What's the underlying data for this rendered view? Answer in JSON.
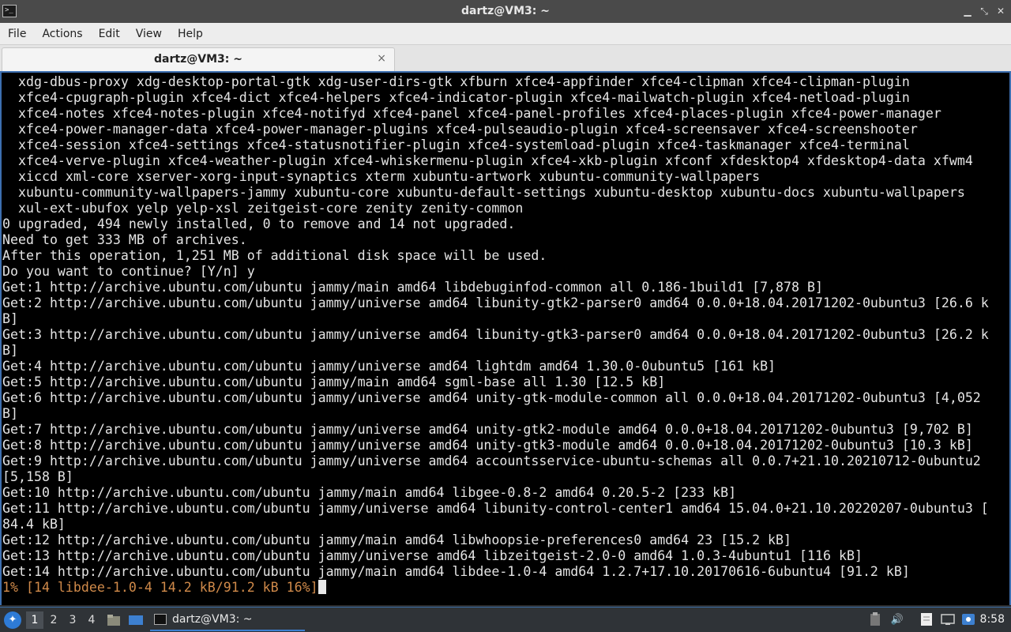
{
  "window": {
    "title": "dartz@VM3: ~",
    "minimize_glyph": "▁",
    "maximize_glyph": "⤡",
    "close_glyph": "✕"
  },
  "menubar": {
    "items": [
      "File",
      "Actions",
      "Edit",
      "View",
      "Help"
    ]
  },
  "tab": {
    "label": "dartz@VM3: ~",
    "close_glyph": "×"
  },
  "terminal": {
    "lines": [
      "  xdg-dbus-proxy xdg-desktop-portal-gtk xdg-user-dirs-gtk xfburn xfce4-appfinder xfce4-clipman xfce4-clipman-plugin",
      "  xfce4-cpugraph-plugin xfce4-dict xfce4-helpers xfce4-indicator-plugin xfce4-mailwatch-plugin xfce4-netload-plugin",
      "  xfce4-notes xfce4-notes-plugin xfce4-notifyd xfce4-panel xfce4-panel-profiles xfce4-places-plugin xfce4-power-manager",
      "  xfce4-power-manager-data xfce4-power-manager-plugins xfce4-pulseaudio-plugin xfce4-screensaver xfce4-screenshooter",
      "  xfce4-session xfce4-settings xfce4-statusnotifier-plugin xfce4-systemload-plugin xfce4-taskmanager xfce4-terminal",
      "  xfce4-verve-plugin xfce4-weather-plugin xfce4-whiskermenu-plugin xfce4-xkb-plugin xfconf xfdesktop4 xfdesktop4-data xfwm4",
      "  xiccd xml-core xserver-xorg-input-synaptics xterm xubuntu-artwork xubuntu-community-wallpapers",
      "  xubuntu-community-wallpapers-jammy xubuntu-core xubuntu-default-settings xubuntu-desktop xubuntu-docs xubuntu-wallpapers",
      "  xul-ext-ubufox yelp yelp-xsl zeitgeist-core zenity zenity-common",
      "0 upgraded, 494 newly installed, 0 to remove and 14 not upgraded.",
      "Need to get 333 MB of archives.",
      "After this operation, 1,251 MB of additional disk space will be used.",
      "Do you want to continue? [Y/n] y",
      "Get:1 http://archive.ubuntu.com/ubuntu jammy/main amd64 libdebuginfod-common all 0.186-1build1 [7,878 B]",
      "Get:2 http://archive.ubuntu.com/ubuntu jammy/universe amd64 libunity-gtk2-parser0 amd64 0.0.0+18.04.20171202-0ubuntu3 [26.6 k",
      "B]",
      "Get:3 http://archive.ubuntu.com/ubuntu jammy/universe amd64 libunity-gtk3-parser0 amd64 0.0.0+18.04.20171202-0ubuntu3 [26.2 k",
      "B]",
      "Get:4 http://archive.ubuntu.com/ubuntu jammy/universe amd64 lightdm amd64 1.30.0-0ubuntu5 [161 kB]",
      "Get:5 http://archive.ubuntu.com/ubuntu jammy/main amd64 sgml-base all 1.30 [12.5 kB]",
      "Get:6 http://archive.ubuntu.com/ubuntu jammy/universe amd64 unity-gtk-module-common all 0.0.0+18.04.20171202-0ubuntu3 [4,052",
      "B]",
      "Get:7 http://archive.ubuntu.com/ubuntu jammy/universe amd64 unity-gtk2-module amd64 0.0.0+18.04.20171202-0ubuntu3 [9,702 B]",
      "Get:8 http://archive.ubuntu.com/ubuntu jammy/universe amd64 unity-gtk3-module amd64 0.0.0+18.04.20171202-0ubuntu3 [10.3 kB]",
      "Get:9 http://archive.ubuntu.com/ubuntu jammy/universe amd64 accountsservice-ubuntu-schemas all 0.0.7+21.10.20210712-0ubuntu2",
      "[5,158 B]",
      "Get:10 http://archive.ubuntu.com/ubuntu jammy/main amd64 libgee-0.8-2 amd64 0.20.5-2 [233 kB]",
      "Get:11 http://archive.ubuntu.com/ubuntu jammy/universe amd64 libunity-control-center1 amd64 15.04.0+21.10.20220207-0ubuntu3 [",
      "84.4 kB]",
      "Get:12 http://archive.ubuntu.com/ubuntu jammy/main amd64 libwhoopsie-preferences0 amd64 23 [15.2 kB]",
      "Get:13 http://archive.ubuntu.com/ubuntu jammy/universe amd64 libzeitgeist-2.0-0 amd64 1.0.3-4ubuntu1 [116 kB]",
      "Get:14 http://archive.ubuntu.com/ubuntu jammy/main amd64 libdee-1.0-4 amd64 1.2.7+17.10.20170616-6ubuntu4 [91.2 kB]"
    ],
    "progress_line": "1% [14 libdee-1.0-4 14.2 kB/91.2 kB 16%]",
    "colors": {
      "background": "#000000",
      "foreground": "#e4e4e4",
      "progress": "#d08a4a",
      "border": "#3d6fb0"
    }
  },
  "taskbar": {
    "start_icon": "xubuntu-start-icon",
    "workspaces": [
      {
        "label": "1",
        "active": true
      },
      {
        "label": "2",
        "active": false
      },
      {
        "label": "3",
        "active": false
      },
      {
        "label": "4",
        "active": false
      }
    ],
    "task_label": "dartz@VM3: ~",
    "clock": "8:58"
  }
}
